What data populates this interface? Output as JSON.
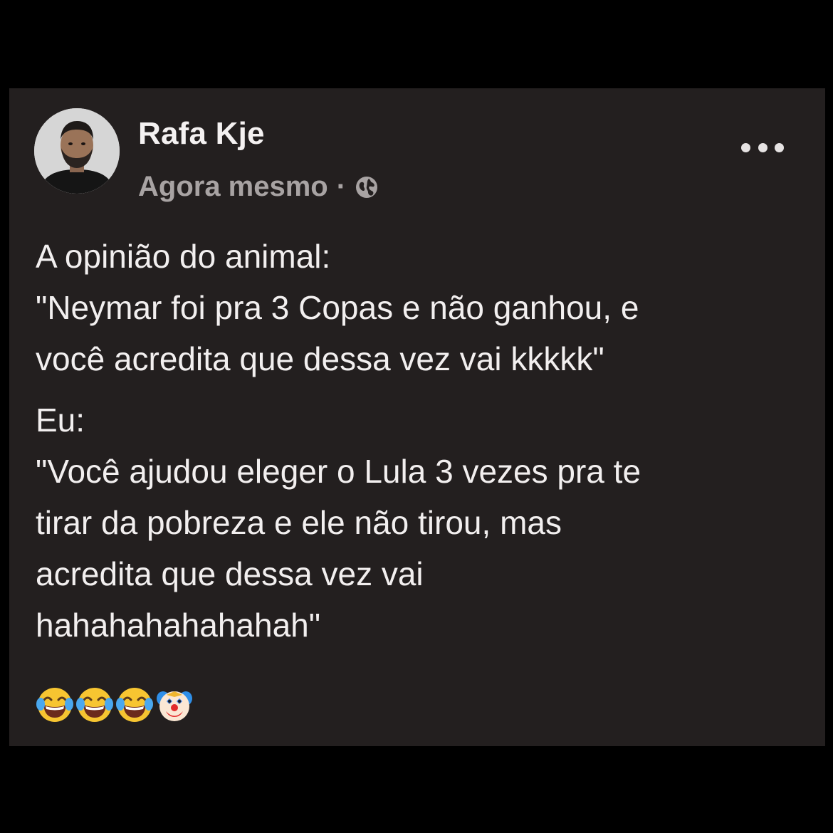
{
  "post": {
    "author": "Rafa Kje",
    "timestamp": "Agora mesmo",
    "separator": "·",
    "privacy_icon": "globe-icon",
    "more_icon": "more-horizontal-icon",
    "body": {
      "paragraph_1": {
        "line_1": "A opinião do animal:",
        "line_2": "\"Neymar foi pra 3 Copas e não ganhou, e",
        "line_3": "você acredita que dessa vez vai kkkkk\""
      },
      "paragraph_2": {
        "line_1": "Eu:",
        "line_2": "\"Você ajudou eleger o Lula 3 vezes pra te",
        "line_3": "tirar da pobreza e ele não tirou, mas",
        "line_4": "acredita que dessa vez vai",
        "line_5": "hahahahahahahah\""
      }
    },
    "reactions_emojis": [
      "tears-of-joy-emoji",
      "tears-of-joy-emoji",
      "tears-of-joy-emoji",
      "clown-emoji"
    ]
  },
  "colors": {
    "page_background": "#000000",
    "card_background": "#231f1f",
    "text_primary": "#f2efef",
    "text_secondary": "#a8a3a3"
  }
}
